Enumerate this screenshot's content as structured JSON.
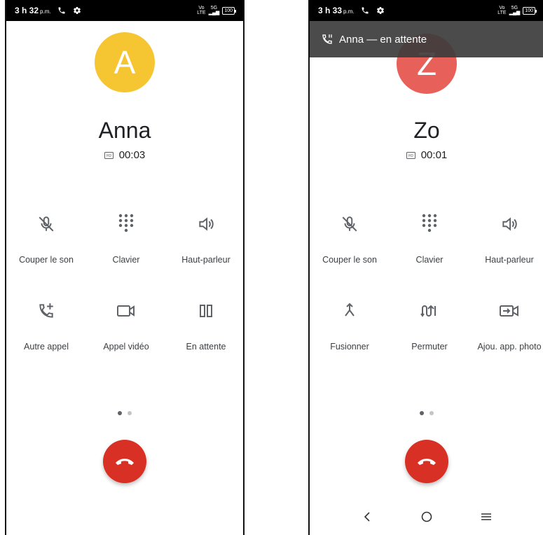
{
  "left": {
    "status": {
      "time": "3 h 32",
      "ampm": "p.m.",
      "network_top": "Vo",
      "network_bottom": "LTE",
      "signal": "5G",
      "battery": "100"
    },
    "avatar": {
      "letter": "A",
      "color": "#f6c532"
    },
    "caller_name": "Anna",
    "timer": "00:03",
    "controls": [
      {
        "label": "Couper le son",
        "icon": "mic-off-icon"
      },
      {
        "label": "Clavier",
        "icon": "dialpad-icon"
      },
      {
        "label": "Haut-parleur",
        "icon": "speaker-icon"
      },
      {
        "label": "Autre appel",
        "icon": "add-call-icon"
      },
      {
        "label": "Appel vidéo",
        "icon": "videocam-icon"
      },
      {
        "label": "En attente",
        "icon": "pause-icon"
      }
    ]
  },
  "right": {
    "status": {
      "time": "3 h 33",
      "ampm": "p.m.",
      "network_top": "Vo",
      "network_bottom": "LTE",
      "signal": "5G",
      "battery": "100"
    },
    "hold_banner": "Anna — en attente",
    "avatar": {
      "letter": "Z",
      "color": "#e8605a"
    },
    "caller_name": "Zo",
    "timer": "00:01",
    "controls": [
      {
        "label": "Couper le son",
        "icon": "mic-off-icon"
      },
      {
        "label": "Clavier",
        "icon": "dialpad-icon"
      },
      {
        "label": "Haut-parleur",
        "icon": "speaker-icon"
      },
      {
        "label": "Fusionner",
        "icon": "merge-icon"
      },
      {
        "label": "Permuter",
        "icon": "swap-icon"
      },
      {
        "label": "Ajou. app. photo",
        "icon": "add-camera-icon"
      }
    ]
  },
  "colors": {
    "end_call": "#d93025",
    "icon": "#5f6368"
  }
}
